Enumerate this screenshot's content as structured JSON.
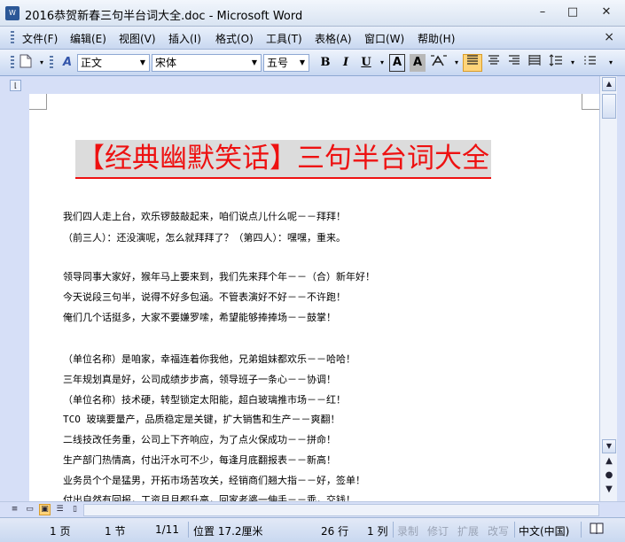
{
  "window": {
    "title": "2016恭贺新春三句半台词大全.doc - Microsoft Word",
    "app_icon": "W"
  },
  "window_controls": {
    "minimize": "–",
    "maximize": "□",
    "close": "✕"
  },
  "menu": {
    "items": [
      "文件(F)",
      "编辑(E)",
      "视图(V)",
      "插入(I)",
      "格式(O)",
      "工具(T)",
      "表格(A)",
      "窗口(W)",
      "帮助(H)"
    ],
    "close": "×"
  },
  "toolbar": {
    "style": "正文",
    "font": "宋体",
    "size": "五号",
    "bold": "B",
    "italic": "I",
    "underline": "U",
    "char_border": "A",
    "char_shading": "A"
  },
  "document": {
    "title": "【经典幽默笑话】三句半台词大全",
    "lines": [
      " 我们四人走上台，欢乐锣鼓敲起来，咱们说点儿什么呢－－拜拜！",
      "（前三人）：还没演呢，怎么就拜拜了？（第四人）：嘿嘿，重来。",
      "",
      "领导同事大家好，猴年马上要来到，我们先来拜个年－－（合）新年好！",
      "今天说段三句半，说得不好多包涵。不管表演好不好－－不许跑！",
      "俺们几个话挺多，大家不要嫌罗嗦，希望能够捧捧场－－鼓掌！",
      "",
      "（单位名称）是咱家，幸福连着你我他，兄弟姐妹都欢乐－－哈哈！",
      "三年规划真是好，公司成绩步步高，领导班子一条心－－协调！",
      "（单位名称）技术硬，转型锁定太阳能，超白玻璃推市场－－红！",
      "TCO 玻璃要量产，品质稳定是关键，扩大销售和生产－－爽翻！",
      "二线技改任务重，公司上下齐响应，为了点火保成功－－拼命！",
      "生产部门热情高，付出汗水可不少，每逢月底翻报表－－新高！",
      "业务员个个是猛男，开拓市场苦攻关，经销商们翘大指－－好，签单！",
      " 付出自然有回报，工资月月都升高，回家老婆一伸手－－乖，交钱！"
    ]
  },
  "status": {
    "page": "1 页",
    "section": "1 节",
    "page_of": "1/11",
    "position": "位置 17.2厘米",
    "line": "26 行",
    "column": "1 列",
    "rec": "录制",
    "trk": "修订",
    "ext": "扩展",
    "ovr": "改写",
    "language": "中文(中国)"
  },
  "colors": {
    "title_red": "#ee1111",
    "title_highlight": "#dcdcdc",
    "chrome_blue": "#d6dff7",
    "active_button": "#ffd47a"
  }
}
